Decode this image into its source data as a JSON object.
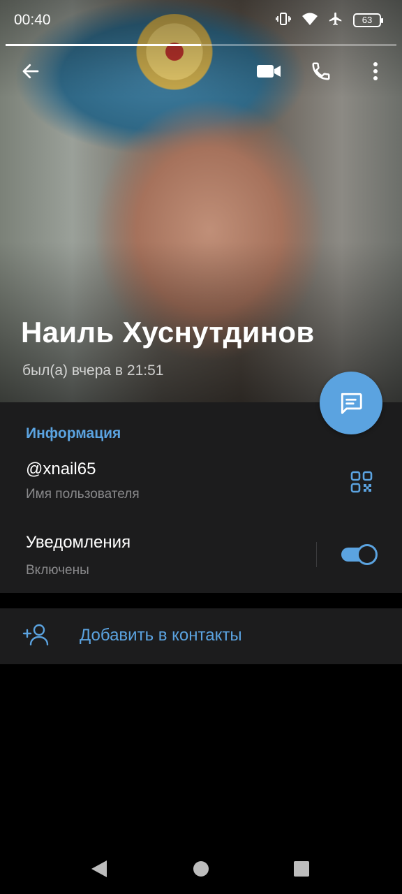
{
  "status_bar": {
    "time": "00:40",
    "battery": "63",
    "icons": [
      "vibrate-icon",
      "wifi-icon",
      "airplane-icon",
      "battery-icon"
    ],
    "story_progress": 0.5
  },
  "toolbar": {
    "back_icon": "arrow-left-icon",
    "video_icon": "video-call-icon",
    "call_icon": "phone-icon",
    "menu_icon": "more-vertical-icon"
  },
  "profile": {
    "name": "Наиль Хуснутдинов",
    "status": "был(а) вчера в 21:51"
  },
  "info": {
    "section_title": "Информация",
    "username": "@xnail65",
    "username_label": "Имя пользователя",
    "notifications_title": "Уведомления",
    "notifications_value": "Включены",
    "notifications_enabled": true
  },
  "actions": {
    "add_contact": "Добавить в контакты"
  },
  "colors": {
    "accent": "#5ba3e0",
    "card_bg": "#1c1c1d",
    "page_bg": "#000000",
    "secondary_text": "#8a8a8c"
  }
}
